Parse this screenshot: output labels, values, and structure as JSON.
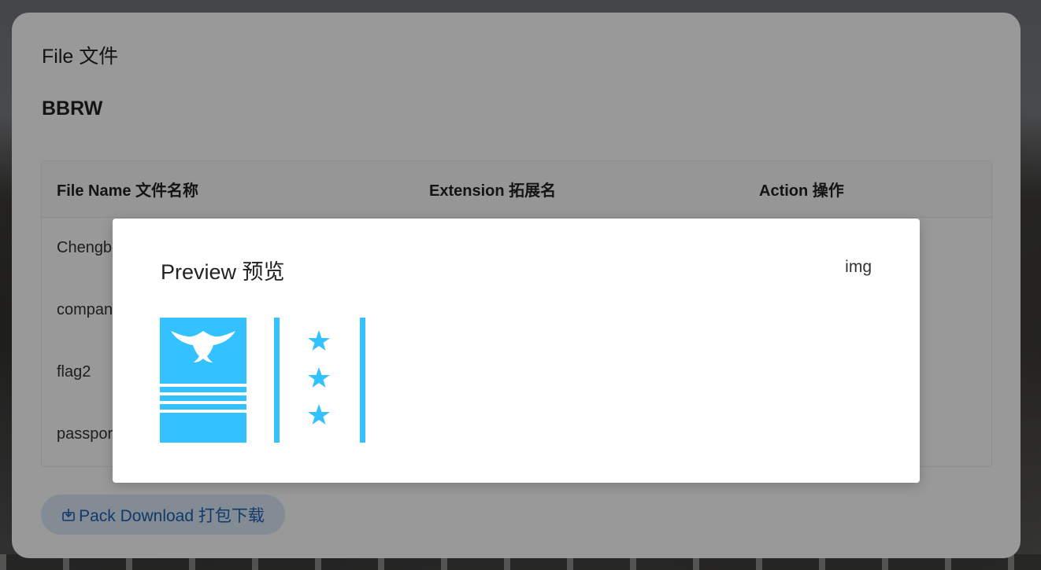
{
  "card": {
    "title": "File 文件",
    "folder_name": "BBRW"
  },
  "table": {
    "headers": {
      "name": "File Name 文件名称",
      "extension": "Extension 拓展名",
      "action": "Action 操作"
    },
    "rows": [
      {
        "name": "Chengb",
        "extension": "",
        "action": ""
      },
      {
        "name": "compan",
        "extension": "",
        "action": ""
      },
      {
        "name": "flag2",
        "extension": "",
        "action": ""
      },
      {
        "name": "passpor",
        "extension": "",
        "action": ""
      }
    ]
  },
  "pack_download": {
    "label": "Pack Download 打包下载",
    "icon": "download-icon"
  },
  "modal": {
    "title": "Preview 预览",
    "type": "img",
    "image": {
      "description_icon": "flag-image",
      "color": "#33c1ff"
    }
  }
}
